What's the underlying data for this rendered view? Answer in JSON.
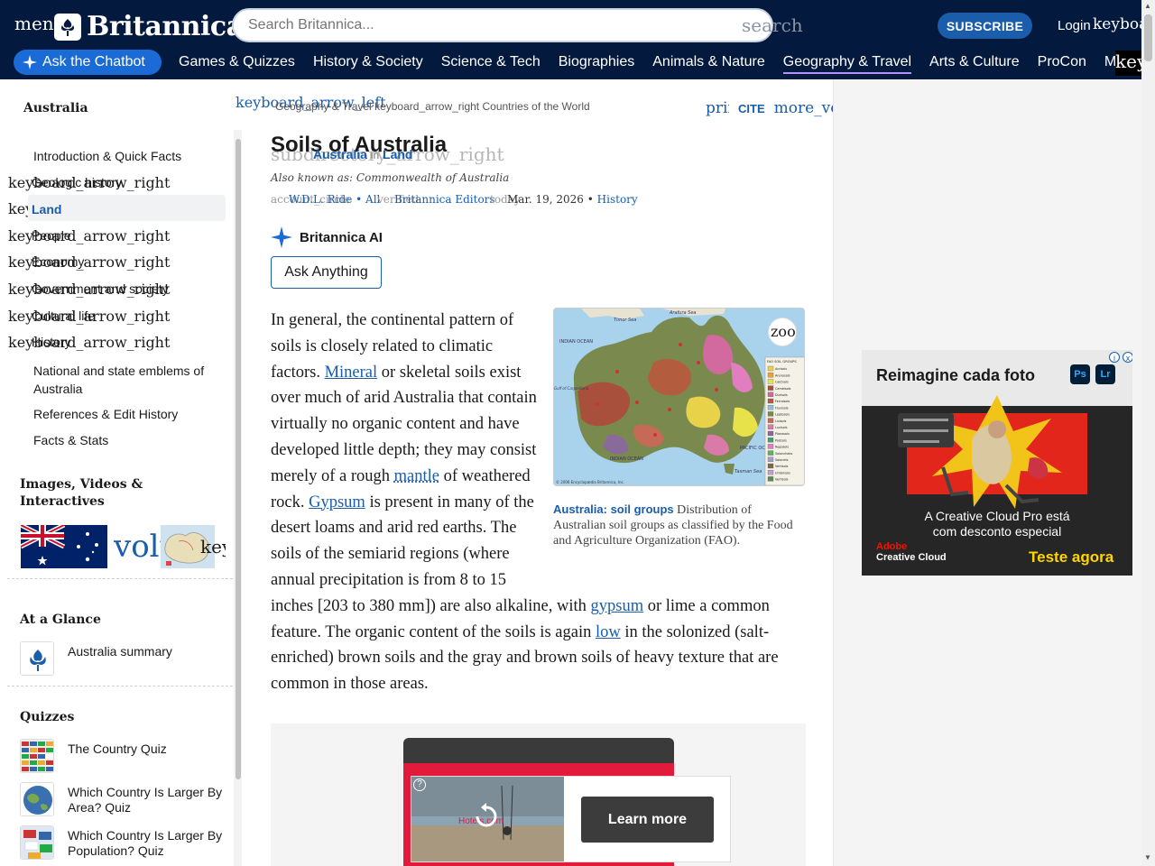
{
  "header": {
    "menu_text": "menu",
    "logo_text": "Britannica",
    "search_placeholder": "Search Britannica...",
    "search_button": "search",
    "subscribe": "SUBSCRIBE",
    "login": "Login",
    "login_icon": "keyboard_arrow_down",
    "chatbot": "Ask the Chatbot",
    "nav": [
      "Games & Quizzes",
      "History & Society",
      "Science & Tech",
      "Biographies",
      "Animals & Nature",
      "Geography & Travel",
      "Arts & Culture",
      "ProCon",
      "Money"
    ],
    "nav_active": "Geography & Travel",
    "nav_more": "keyboard_arrow_right",
    "colors": {
      "bar": "#03193d",
      "accent": "#1a5dab",
      "chatbot": "#1a6bd6",
      "active_underline": "#b58fff"
    }
  },
  "sidebar": {
    "title": "Australia",
    "toc": [
      {
        "label": "Introduction & Quick Facts",
        "expandable": false
      },
      {
        "label": "Geologic history",
        "expandable": true,
        "icon": "keyboard_arrow_right"
      },
      {
        "label": "Land",
        "expandable": true,
        "icon": "keyboard_arrow_right",
        "active": true
      },
      {
        "label": "People",
        "expandable": true,
        "icon": "keyboard_arrow_right"
      },
      {
        "label": "Economy",
        "expandable": true,
        "icon": "keyboard_arrow_right"
      },
      {
        "label": "Government and society",
        "expandable": true,
        "icon": "keyboard_arrow_right"
      },
      {
        "label": "Cultural life",
        "expandable": true,
        "icon": "keyboard_arrow_right"
      },
      {
        "label": "History",
        "expandable": true,
        "icon": "keyboard_arrow_right"
      },
      {
        "label": "National and state emblems of Australia",
        "expandable": false
      },
      {
        "label": "References & Edit History",
        "expandable": false
      },
      {
        "label": "Facts & Stats",
        "expandable": false
      }
    ],
    "media_heading": "Images, Videos & Interactives",
    "media_video_icon": "volume_up",
    "media_more_icon": "keyboard_arrow_right",
    "glance_heading": "At a Glance",
    "glance_item": "Australia summary",
    "quiz_heading": "Quizzes",
    "quizzes": [
      "The Country Quiz",
      "Which Country Is Larger By Area? Quiz",
      "Which Country Is Larger By Population? Quiz"
    ]
  },
  "article": {
    "breadcrumb_back": "keyboard_arrow_left",
    "breadcrumb": [
      "Geography & Travel",
      "Countries of the World"
    ],
    "breadcrumb_sep": "keyboard_arrow_right",
    "print": "print",
    "cite": "CITE",
    "more": "more_vert",
    "title": "Soils of Australia",
    "subdir_icon": "subdirectory_arrow_right",
    "sub_links": [
      "Australia",
      "Land"
    ],
    "sub_links_sep": "in",
    "also_known": "Also known as: Commonwealth of Australia",
    "byline": {
      "author_icon": "account_circle",
      "authors": "W.D.L. Ride",
      "authors_more": "All",
      "verified_icon": "verified",
      "editor": "Britannica Editors",
      "date_icon": "today",
      "date": "Mar. 19, 2026",
      "history": "History"
    },
    "ai_label": "Britannica AI",
    "ask": "Ask Anything",
    "body": {
      "p1": "In general, the continental pattern of soils is closely related to climatic factors.",
      "link1": "Mineral",
      "p2": "or skeletal soils exist over much of arid Australia that contain virtually no organic content and have developed little depth; they may consist merely of a rough",
      "link2": "mantle",
      "p3": "of weathered rock.",
      "link3": "Gypsum",
      "p4": "is present in many of the desert loams and arid red earths. The soils of the semiarid regions (where annual precipitation is from 8 to 15 inches [203 to 380 mm]) are also alkaline, with",
      "link4": "gypsum",
      "p5": "or lime a common feature. The organic content of the soils is again",
      "link5": "low",
      "p6": "in the solonized (salt-enriched) brown soils and the gray and brown soils of heavy texture that are common in those areas."
    },
    "figure": {
      "zoom": "zoom_in",
      "caption_title": "Australia: soil groups",
      "caption_text": "Distribution of Australian soil groups as classified by the Food and Agriculture Organization (FAO).",
      "map_labels": [
        "Timor Sea",
        "Arafura Sea",
        "INDIAN OCEAN",
        "Gulf of Carpentaria",
        "INDIAN OCEAN",
        "PACIFIC OCEAN",
        "Tasman Sea",
        "Coral Sea",
        "FAO SOIL GROUPS",
        "© 2006 Encyclopædia Britannica, Inc."
      ],
      "legend": [
        "Acrisols",
        "Arenosols",
        "Calcisols",
        "Cambisols",
        "Durisols",
        "Ferralsols",
        "Fluvisols",
        "Leptosols",
        "Lixisols",
        "Luvisols",
        "Planosols",
        "Podzols",
        "Regosols",
        "Solonchaks",
        "Solonetz",
        "Vertisols",
        "Umbrisols",
        "Vertisols"
      ]
    }
  },
  "ads": {
    "bottom": {
      "learn_more": "Learn more",
      "help": "?",
      "brand": "Hotels.com",
      "replay_icon": "replay-icon"
    },
    "side": {
      "title": "Reimagine cada foto",
      "ps": "Ps",
      "lr": "Lr",
      "info": "i",
      "close": "x",
      "promo_line1": "A Creative Cloud Pro está",
      "promo_line2": "com desconto especial",
      "brand1": "Adobe",
      "brand2": "Creative Cloud",
      "cta": "Teste agora"
    }
  }
}
